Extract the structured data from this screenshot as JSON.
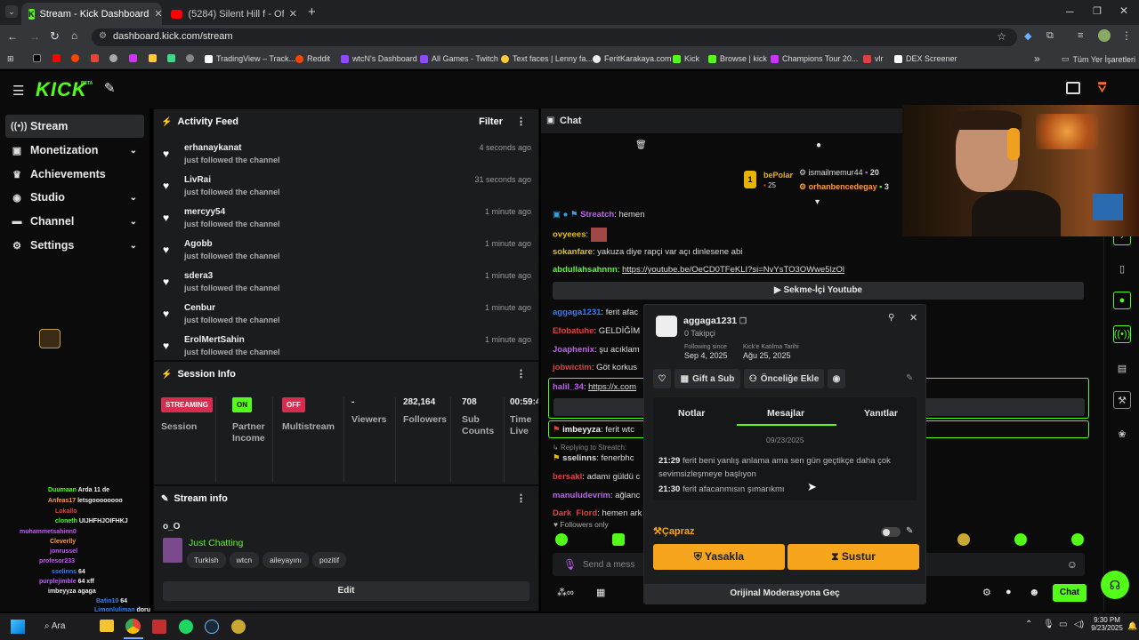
{
  "browser": {
    "tabs": [
      {
        "title": "Stream - Kick Dashboard"
      },
      {
        "title": "(5284) Silent Hill f - Official Lau"
      }
    ],
    "url": "dashboard.kick.com/stream",
    "bookmarks": [
      "TradingView – Track...",
      "Reddit",
      "wtcN's Dashboard",
      "All Games - Twitch",
      "Text faces | Lenny fa...",
      "FeritKarakaya.com",
      "Kick",
      "Browse | kick",
      "Champions Tour 20...",
      "vlr",
      "DEX Screener"
    ],
    "bookmarks_folder": "Tüm Yer İşaretleri",
    "bookmarks_more": "»"
  },
  "logo": {
    "text": "KICK",
    "sup": "BETA"
  },
  "sidebar": {
    "items": [
      {
        "label": "Stream",
        "icon": "radio-icon"
      },
      {
        "label": "Monetization",
        "icon": "monetization-icon",
        "chevron": "⌄"
      },
      {
        "label": "Achievements",
        "icon": "achievement-icon"
      },
      {
        "label": "Studio",
        "icon": "studio-icon",
        "chevron": "⌄"
      },
      {
        "label": "Channel",
        "icon": "channel-icon",
        "chevron": "⌄"
      },
      {
        "label": "Settings",
        "icon": "gear-icon",
        "chevron": "⌄"
      }
    ]
  },
  "activity": {
    "title": "Activity Feed",
    "filter": "Filter",
    "items": [
      {
        "name": "erhanaykanat",
        "action": "just followed the channel",
        "time": "4 seconds ago"
      },
      {
        "name": "LivRai",
        "action": "just followed the channel",
        "time": "31 seconds ago"
      },
      {
        "name": "mercyy54",
        "action": "just followed the channel",
        "time": "1 minute ago"
      },
      {
        "name": "Agobb",
        "action": "just followed the channel",
        "time": "1 minute ago"
      },
      {
        "name": "sdera3",
        "action": "just followed the channel",
        "time": "1 minute ago"
      },
      {
        "name": "Cenbur",
        "action": "just followed the channel",
        "time": "1 minute ago"
      },
      {
        "name": "ErolMertSahin",
        "action": "just followed the channel",
        "time": "1 minute ago"
      }
    ]
  },
  "session": {
    "title": "Session Info",
    "streaming_badge": "STREAMING",
    "session_label": "Session",
    "partner_badge": "ON",
    "partner_label": "Partner Income",
    "multi_badge": "OFF",
    "multi_label": "Multistream",
    "viewers_value": "-",
    "viewers_label": "Viewers",
    "followers_value": "282,164",
    "followers_label": "Followers",
    "subs_value": "708",
    "subs_label": "Sub Counts",
    "time_value": "00:59:4",
    "time_label": "Time Live"
  },
  "stream_info": {
    "title": "Stream info",
    "stream_title": "o_O",
    "category": "Just Chatting",
    "tags": [
      "Turkish",
      "wtcn",
      "aileyayını",
      "pozitif"
    ],
    "edit": "Edit"
  },
  "chat": {
    "title": "Chat",
    "top_users": [
      {
        "name": "bePolar",
        "count": "25"
      },
      {
        "name": "ismailmemur44",
        "count": "20"
      },
      {
        "name": "orhanbencedegay",
        "count": "3"
      }
    ],
    "messages": [
      {
        "user": "Streatch",
        "text": "hemen",
        "color": "#c35cf5"
      },
      {
        "user": "ovyeees",
        "text": "",
        "color": "#e5c100"
      },
      {
        "user": "sokanfare",
        "text": "yakuza diye rapçi var açı dinlesene abi",
        "color": "#e5c100"
      },
      {
        "user": "abdullahsahnnn",
        "text": "https://youtube.be/OeCD0TFeKLI?si=NvYsTO3OWwe5lzOl",
        "color": "#53fc18"
      }
    ],
    "youtube_bar": "Sekme-İçi Youtube",
    "messages2": [
      {
        "user": "aggaga1231",
        "text": "ferit afac",
        "color": "#2d7ff9"
      },
      {
        "user": "Efobatuhe",
        "text": "GELDİĞİM",
        "color": "#e04040"
      },
      {
        "user": "Joaphenix",
        "text": "şu acıklam",
        "color": "#c35cf5"
      },
      {
        "user": "jobwictim",
        "text": "Göt korkus",
        "color": "#e04040"
      },
      {
        "user": "halil_34",
        "text": "https://x.com",
        "color": "#c35cf5"
      },
      {
        "user": "imbeyyza",
        "text": "ferit wtc",
        "color": "#eee"
      },
      {
        "user": "Replying to Streatch:",
        "text": "",
        "color": "#888"
      },
      {
        "user": "sselinns",
        "text": "fenerbhc",
        "color": "#eee"
      },
      {
        "user": "bersakl",
        "text": "adamı güldü c",
        "color": "#e04040"
      },
      {
        "user": "manuludevrim",
        "text": "ağlanc",
        "color": "#c35cf5"
      },
      {
        "user": "Dark_Flord",
        "text": "hemen ark",
        "color": "#e04040"
      }
    ],
    "followers_only": "Followers only",
    "send_placeholder": "Send a mess",
    "chat_button": "Chat"
  },
  "modal": {
    "username": "aggaga1231",
    "followers": "0 Takipçi",
    "following_since_label": "Following since",
    "following_since": "Sep 4, 2025",
    "joined_label": "Kick'e Katılma Tarihi",
    "joined": "Ağu 25, 2025",
    "gift_sub": "Gift a Sub",
    "priority": "Önceliğe Ekle",
    "tabs": [
      "Notlar",
      "Mesajlar",
      "Yanıtlar"
    ],
    "date": "09/23/2025",
    "messages": [
      {
        "time": "21:29",
        "text": "ferit beni yanlış anlama ama sen gün geçtikçe daha çok sevimsizleşmeye başlıyon"
      },
      {
        "time": "21:30",
        "text": "ferit afacanmısın şımarıkmı"
      }
    ],
    "capraz": "Çapraz",
    "ban": "Yasakla",
    "mute": "Sustur",
    "original_mod": "Orijinal Moderasyona Geç"
  },
  "overlay_chat": [
    {
      "user": "Duumaan",
      "text": "Arda 11 de",
      "color": "#53fc18"
    },
    {
      "user": "Anfeas17",
      "text": "letsgoooooooo",
      "color": "#ff9a3c"
    },
    {
      "user": "Lokallo",
      "text": "",
      "color": "#e04040"
    },
    {
      "user": "cloneth",
      "text": "UIJHFHJOIFHKJ",
      "color": "#53fc18"
    },
    {
      "user": "muhammetsahinn0",
      "text": "",
      "color": "#c35cf5"
    },
    {
      "user": "Cleverlly",
      "text": "",
      "color": "#ff9a3c"
    },
    {
      "user": "jonrussel",
      "text": "",
      "color": "#c35cf5"
    },
    {
      "user": "profesor233",
      "text": "",
      "color": "#c35cf5"
    },
    {
      "user": "sselinns",
      "text": "64",
      "color": "#2d7ff9"
    },
    {
      "user": "purplejimble",
      "text": "64 xff",
      "color": "#c35cf5"
    },
    {
      "user": "imbeyyza",
      "text": "agaga",
      "color": "#eee"
    },
    {
      "user": "Batin10",
      "text": "64",
      "color": "#2d7ff9"
    },
    {
      "user": "Limonluliman",
      "text": "doru",
      "color": "#2d7ff9"
    }
  ],
  "taskbar": {
    "search": "Ara",
    "time": "9:30 PM",
    "date": "9/23/2025"
  }
}
